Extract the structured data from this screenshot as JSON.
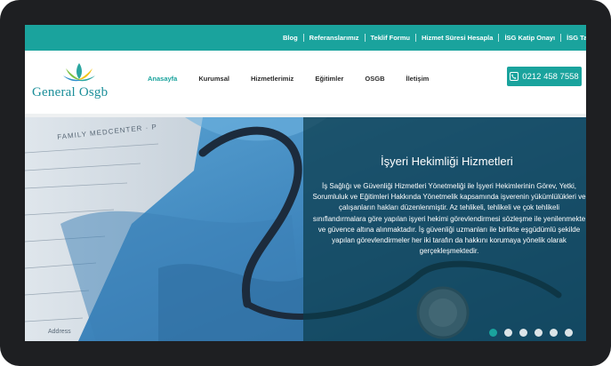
{
  "topbar": {
    "links": [
      "Blog",
      "Referanslarımız",
      "Teklif Formu",
      "Hizmet Süresi Hesapla",
      "İSG Katip Onayı",
      "İSG Takip"
    ]
  },
  "brand": {
    "name": "General Osgb",
    "logo_colors": [
      "#2aa6a0",
      "#7dc243",
      "#f2c318",
      "#2e8fcb"
    ]
  },
  "nav": {
    "items": [
      "Anasayfa",
      "Kurumsal",
      "Hizmetlerimiz",
      "Eğitimler",
      "OSGB",
      "İletişim"
    ],
    "active": "Anasayfa"
  },
  "contact": {
    "phone": "0212 458 7558"
  },
  "hero": {
    "title": "İşyeri Hekimliği Hizmetleri",
    "text": "İş Sağlığı ve Güvenliği Hizmetleri Yönetmeliği ile İşyeri Hekimlerinin Görev, Yetki, Sorumluluk ve Eğitimleri Hakkında Yönetmelik kapsamında işverenin yükümlülükleri ve çalışanların hakları düzenlenmiştir. Az tehlikeli, tehlikeli ve çok tehlikeli sınıflandırmalara göre yapılan işyeri hekimi görevlendirmesi sözleşme ile yenilenmekte ve güvence altına alınmaktadır. İş güvenliği uzmanları ile birlikte eşgüdümlü şekilde yapılan görevlendirmeler her iki tarafın da hakkını korumaya yönelik olarak gerçekleşmektedir.",
    "background_form_text": [
      "FAMILY MEDCENTER · P",
      "Address"
    ]
  },
  "slider": {
    "count": 6,
    "active_index": 0
  },
  "colors": {
    "accent": "#1aa39d",
    "overlay": "#0a3a4a",
    "frame": "#1e1f22"
  }
}
